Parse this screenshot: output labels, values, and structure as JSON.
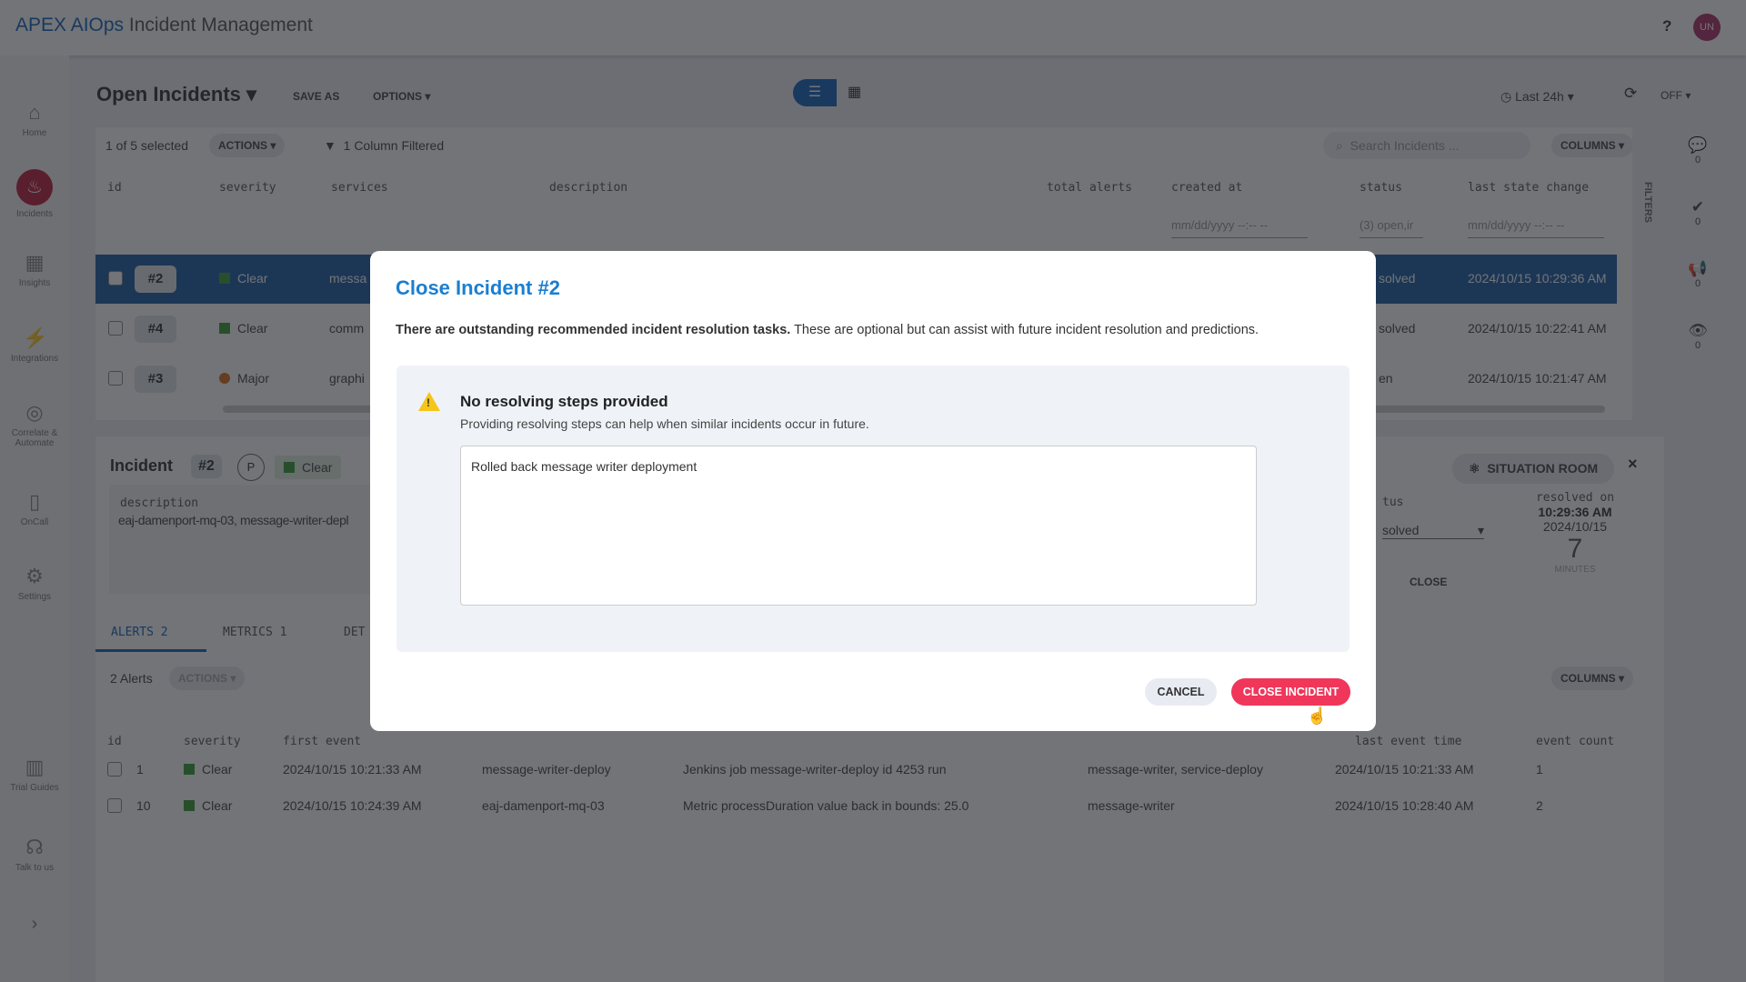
{
  "header": {
    "brand": "APEX AIOps",
    "title": "Incident Management",
    "help": "?",
    "avatar": "UN"
  },
  "sidebar": {
    "items": [
      {
        "label": "Home",
        "icon": "home-icon"
      },
      {
        "label": "Incidents",
        "icon": "flame-icon"
      },
      {
        "label": "Insights",
        "icon": "dashboard-icon"
      },
      {
        "label": "Integrations",
        "icon": "plug-icon"
      },
      {
        "label": "Correlate & Automate",
        "icon": "target-icon"
      },
      {
        "label": "OnCall",
        "icon": "phone-icon"
      },
      {
        "label": "Settings",
        "icon": "gear-icon"
      },
      {
        "label": "Trial Guides",
        "icon": "books-icon"
      },
      {
        "label": "Talk to us",
        "icon": "headset-icon"
      }
    ],
    "expand": "›"
  },
  "toolbar": {
    "view_title": "Open Incidents",
    "save_as": "SAVE AS",
    "options": "OPTIONS",
    "time_range": "Last 24h",
    "refresh": "OFF"
  },
  "list": {
    "selected": "1 of 5 selected",
    "actions": "ACTIONS",
    "filter_status": "1 Column Filtered",
    "search_placeholder": "Search Incidents ...",
    "columns": "COLUMNS",
    "filters_tab": "FILTERS",
    "headers": [
      "id",
      "severity",
      "services",
      "description",
      "total alerts",
      "created at",
      "status",
      "last state change"
    ],
    "filters": {
      "created_at": "mm/dd/yyyy --:-- --",
      "status": "(3) open,ir",
      "last_state": "mm/dd/yyyy --:-- --"
    },
    "rows": [
      {
        "id": "#2",
        "severity": "Clear",
        "services": "messa",
        "status": "solved",
        "last": "2024/10/15 10:29:36 AM",
        "checked": true
      },
      {
        "id": "#4",
        "severity": "Clear",
        "services": "comm",
        "status": "solved",
        "last": "2024/10/15 10:22:41 AM",
        "checked": false
      },
      {
        "id": "#3",
        "severity": "Major",
        "services": "graphi",
        "status": "en",
        "last": "2024/10/15 10:21:47 AM",
        "checked": false
      }
    ]
  },
  "rail": {
    "counts": [
      "0",
      "0",
      "0",
      "0"
    ]
  },
  "incident": {
    "label": "Incident",
    "id": "#2",
    "p": "P",
    "severity": "Clear",
    "desc_label": "description",
    "desc": "eaj-damenport-mq-03, message-writer-depl",
    "situation_room": "SITUATION ROOM",
    "status_label": "tus",
    "status_value": "solved",
    "close": "CLOSE",
    "resolved_label": "resolved on",
    "resolved_time": "10:29:36 AM",
    "resolved_date": "2024/10/15",
    "duration": "7",
    "duration_unit": "MINUTES"
  },
  "tabs": [
    {
      "label": "ALERTS",
      "count": "2"
    },
    {
      "label": "METRICS",
      "count": "1"
    },
    {
      "label": "DET",
      "count": ""
    }
  ],
  "alerts": {
    "count": "2 Alerts",
    "actions": "ACTIONS",
    "columns": "COLUMNS",
    "headers": [
      "id",
      "severity",
      "first event",
      "last event time",
      "event count"
    ],
    "rows": [
      {
        "id": "1",
        "severity": "Clear",
        "first": "2024/10/15 10:21:33 AM",
        "source": "message-writer-deploy",
        "desc": "Jenkins job message-writer-deploy id 4253 run",
        "services": "message-writer, service-deploy",
        "last": "2024/10/15 10:21:33 AM",
        "count": "1"
      },
      {
        "id": "10",
        "severity": "Clear",
        "first": "2024/10/15 10:24:39 AM",
        "source": "eaj-damenport-mq-03",
        "desc": "Metric processDuration value back in bounds: 25.0",
        "services": "message-writer",
        "last": "2024/10/15 10:28:40 AM",
        "count": "2"
      }
    ]
  },
  "modal": {
    "title": "Close Incident #2",
    "msg_bold": "There are outstanding recommended incident resolution tasks.",
    "msg": " These are optional but can assist with future incident resolution and predictions.",
    "warn_title": "No resolving steps provided",
    "warn_text": "Providing resolving steps can help when similar incidents occur in future.",
    "steps_value": "Rolled back message writer deployment",
    "cancel": "CANCEL",
    "confirm": "CLOSE INCIDENT"
  },
  "colors": {
    "accent": "#1a7fd1",
    "danger": "#f0365a",
    "clear": "#3a9f3a",
    "major": "#e07020"
  }
}
